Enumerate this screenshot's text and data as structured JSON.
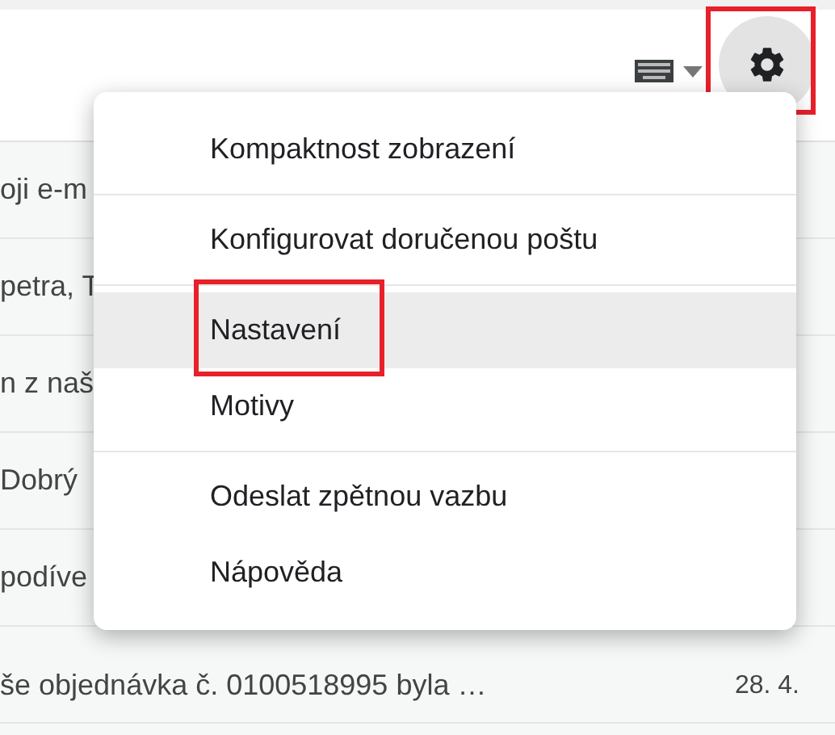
{
  "toolbar": {
    "settings_button": {
      "annotated": true
    }
  },
  "messages": [
    {
      "snippet": "oji e-m"
    },
    {
      "snippet": "petra, T"
    },
    {
      "snippet": "n z naš"
    },
    {
      "snippet": "Dobrý"
    },
    {
      "snippet": "podíve"
    },
    {
      "snippet": "še objednávka č. 0100518995 byla …",
      "date": "28. 4."
    }
  ],
  "menu": {
    "groups": [
      [
        {
          "label": "Kompaktnost zobrazení",
          "selected": false,
          "annotated": false
        }
      ],
      [
        {
          "label": "Konfigurovat doručenou poštu",
          "selected": false,
          "annotated": false
        }
      ],
      [
        {
          "label": "Nastavení",
          "selected": true,
          "annotated": true
        },
        {
          "label": "Motivy",
          "selected": false,
          "annotated": false
        }
      ],
      [
        {
          "label": "Odeslat zpětnou vazbu",
          "selected": false,
          "annotated": false
        },
        {
          "label": "Nápověda",
          "selected": false,
          "annotated": false
        }
      ]
    ]
  }
}
